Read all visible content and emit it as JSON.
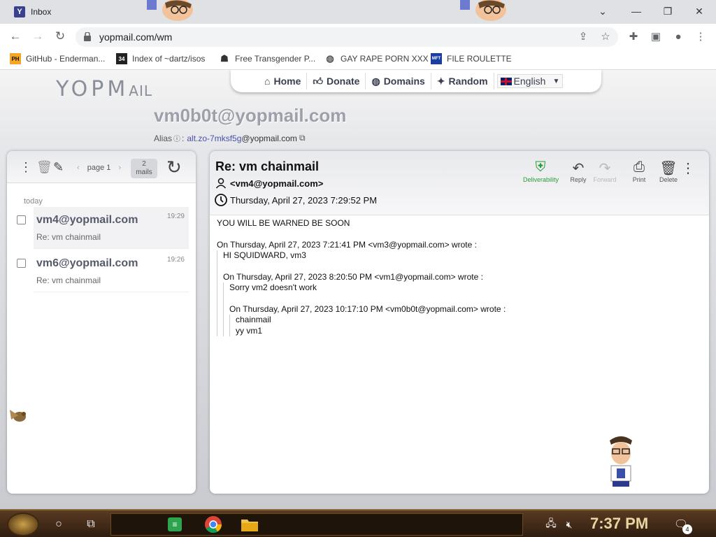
{
  "browser": {
    "tab_title": "Inbox",
    "tab_favicon": "Y",
    "url": "yopmail.com/wm",
    "bookmarks": [
      {
        "label": "GitHub - Enderman...",
        "icon": "PH"
      },
      {
        "label": "Index of ~dartz/isos",
        "icon": "34"
      },
      {
        "label": "Free Transgender P...",
        "icon": "mask-icon"
      },
      {
        "label": "GAY RAPE PORN XXX",
        "icon": "globe-icon"
      },
      {
        "label": "FILE ROULETTE",
        "icon": "MFT"
      }
    ]
  },
  "site": {
    "logo_main": "YOPM",
    "logo_small": "AIL",
    "menu": [
      {
        "label": "Home",
        "icon": "home-icon"
      },
      {
        "label": "Donate",
        "icon": "thumbs-up-icon"
      },
      {
        "label": "Domains",
        "icon": "globe-icon"
      },
      {
        "label": "Random",
        "icon": "wand-icon"
      }
    ],
    "language": "English",
    "address": "vm0b0t@yopmail.com",
    "alias_label": "Alias",
    "alias_value": "alt.zo-7mksf5g",
    "alias_domain": "@yopmail.com"
  },
  "inbox": {
    "page_label": "page 1",
    "count_number": "2",
    "count_label": "mails",
    "group_label": "today",
    "mails": [
      {
        "from": "vm4@yopmail.com",
        "subject": "Re: vm chainmail",
        "time": "19:29"
      },
      {
        "from": "vm6@yopmail.com",
        "subject": "Re: vm chainmail",
        "time": "19:26"
      }
    ]
  },
  "message": {
    "subject": "Re: vm chainmail",
    "sender": "<vm4@yopmail.com>",
    "date": "Thursday, April 27, 2023 7:29:52 PM",
    "actions": {
      "deliverability": "Deliverability",
      "reply": "Reply",
      "forward": "Forward",
      "print": "Print",
      "delete": "Delete"
    },
    "body_line1": "YOU WILL BE WARNED BE SOON",
    "q1_header": "On Thursday, April 27, 2023 7:21:41 PM <vm3@yopmail.com> wrote :",
    "q1_text": "HI SQUIDWARD, vm3",
    "q2_header": "On Thursday, April 27, 2023 8:20:50 PM <vm1@yopmail.com> wrote :",
    "q2_text": "Sorry vm2 doesn't work",
    "q3_header": "On Thursday, April 27, 2023 10:17:10 PM <vm0b0t@yopmail.com> wrote :",
    "q3_text1": "chainmail",
    "q3_text2": "yy vm1"
  },
  "taskbar": {
    "clock": "7:37 PM",
    "notification_count": "4"
  }
}
